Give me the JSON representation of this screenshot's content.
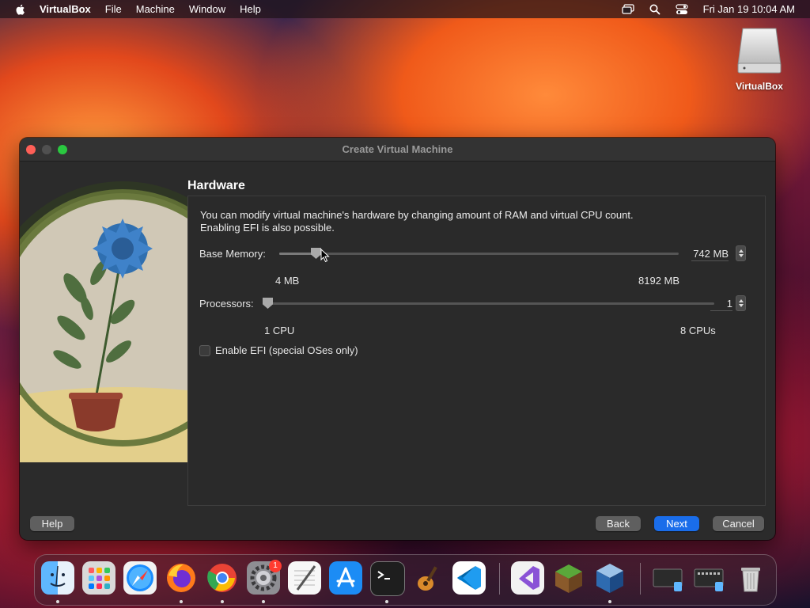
{
  "menubar": {
    "app_name": "VirtualBox",
    "items": [
      "File",
      "Machine",
      "Window",
      "Help"
    ],
    "clock": "Fri Jan 19  10:04 AM"
  },
  "desktop": {
    "disk_label": "VirtualBox"
  },
  "window": {
    "title": "Create Virtual Machine",
    "heading": "Hardware",
    "description_line1": "You can modify virtual machine's hardware by changing amount of RAM and virtual CPU count.",
    "description_line2": "Enabling EFI is also possible.",
    "memory": {
      "label": "Base Memory:",
      "value": "742 MB",
      "value_mb": 742,
      "min_label": "4 MB",
      "max_label": "8192 MB",
      "min_mb": 4,
      "max_mb": 8192
    },
    "processors": {
      "label": "Processors:",
      "value": "1",
      "value_count": 1,
      "min_label": "1 CPU",
      "max_label": "8 CPUs",
      "min": 1,
      "max": 8
    },
    "efi": {
      "label": "Enable EFI (special OSes only)",
      "checked": false
    },
    "buttons": {
      "help": "Help",
      "back": "Back",
      "next": "Next",
      "cancel": "Cancel"
    },
    "accent_color": "#1a6dea"
  },
  "dock": {
    "badges": {
      "system_settings": "1"
    }
  }
}
